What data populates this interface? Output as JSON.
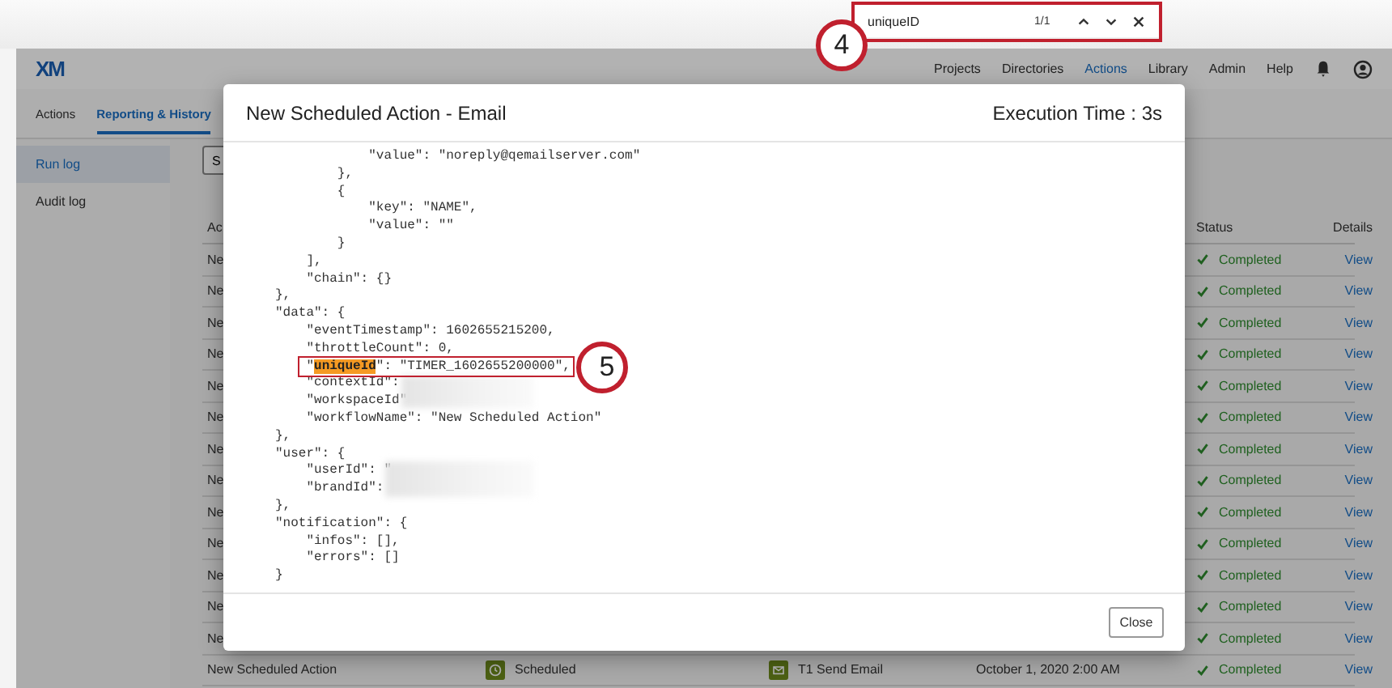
{
  "find_bar": {
    "value": "uniqueID",
    "count": "1/1"
  },
  "callouts": [
    {
      "number": "4",
      "kind": "find"
    },
    {
      "number": "5",
      "kind": "line"
    }
  ],
  "header": {
    "logo": "XM",
    "nav": [
      {
        "label": "Projects",
        "selected": false
      },
      {
        "label": "Directories",
        "selected": false
      },
      {
        "label": "Actions",
        "selected": true
      },
      {
        "label": "Library",
        "selected": false
      },
      {
        "label": "Admin",
        "selected": false
      },
      {
        "label": "Help",
        "selected": false
      }
    ]
  },
  "tabs": [
    {
      "label": "Actions",
      "selected": false
    },
    {
      "label": "Reporting & History",
      "selected": true
    }
  ],
  "sidebar": {
    "items": [
      {
        "label": "Run log",
        "selected": true
      },
      {
        "label": "Audit log",
        "selected": false
      }
    ]
  },
  "search": {
    "value": "S"
  },
  "table": {
    "columns": [
      "Ac",
      "Status",
      "Details"
    ],
    "rows": [
      {
        "action": "Ne",
        "status": {
          "text": "Completed",
          "kind": "completed"
        },
        "details": "View"
      },
      {
        "action": "Ne",
        "status": {
          "text": "Completed",
          "kind": "completed"
        },
        "details": "View"
      },
      {
        "action": "Ne",
        "status": {
          "text": "Completed",
          "kind": "completed"
        },
        "details": "View"
      },
      {
        "action": "Ne",
        "status": {
          "text": "Completed",
          "kind": "completed"
        },
        "details": "View"
      },
      {
        "action": "Ne",
        "status": {
          "text": "Completed",
          "kind": "completed"
        },
        "details": "View"
      },
      {
        "action": "Ne",
        "status": {
          "text": "Completed",
          "kind": "completed"
        },
        "details": "View"
      },
      {
        "action": "Ne",
        "status": {
          "text": "Completed",
          "kind": "completed"
        },
        "details": "View"
      },
      {
        "action": "Ne",
        "status": {
          "text": "Completed",
          "kind": "completed"
        },
        "details": "View"
      },
      {
        "action": "Ne",
        "status": {
          "text": "Completed",
          "kind": "completed"
        },
        "details": "View"
      },
      {
        "action": "Ne",
        "status": {
          "text": "Completed",
          "kind": "completed"
        },
        "details": "View"
      },
      {
        "action": "Ne",
        "status": {
          "text": "Completed",
          "kind": "completed"
        },
        "details": "View"
      },
      {
        "action": "Ne",
        "status": {
          "text": "Completed",
          "kind": "completed"
        },
        "details": "View"
      },
      {
        "action": "Ne",
        "status": {
          "text": "Completed",
          "kind": "completed"
        },
        "details": "View"
      },
      {
        "action": "New Scheduled Action",
        "trigger": "Scheduled",
        "task": "T1 Send Email",
        "date": "October 1, 2020 2:00 AM",
        "status": {
          "text": "Completed",
          "kind": "completed"
        },
        "details": "View"
      }
    ]
  },
  "modal": {
    "title": "New Scheduled Action - Email",
    "execution_time": "Execution Time : 3s",
    "close": "Close",
    "lines": [
      {
        "kind": "plain",
        "text": "            \"value\": \"noreply@qemailserver.com\""
      },
      {
        "kind": "plain",
        "text": "        },"
      },
      {
        "kind": "plain",
        "text": "        {"
      },
      {
        "kind": "plain",
        "text": "            \"key\": \"NAME\","
      },
      {
        "kind": "plain",
        "text": "            \"value\": \"\""
      },
      {
        "kind": "plain",
        "text": "        }"
      },
      {
        "kind": "plain",
        "text": "    ],"
      },
      {
        "kind": "plain",
        "text": "    \"chain\": {}"
      },
      {
        "kind": "plain",
        "text": "},"
      },
      {
        "kind": "plain",
        "text": "\"data\": {"
      },
      {
        "kind": "plain",
        "text": "    \"eventTimestamp\": 1602655215200,"
      },
      {
        "kind": "plain",
        "text": "    \"throttleCount\": 0,"
      },
      {
        "kind": "match",
        "parts": [
          "    \"",
          "uniqueId",
          "\": \"TIMER_1602655200000\","
        ]
      },
      {
        "kind": "plain",
        "text": "    \"contextId\":"
      },
      {
        "kind": "plain",
        "text": "    \"workspaceId\""
      },
      {
        "kind": "plain",
        "text": "    \"workflowName\": \"New Scheduled Action\""
      },
      {
        "kind": "plain",
        "text": "},"
      },
      {
        "kind": "plain",
        "text": "\"user\": {"
      },
      {
        "kind": "plain",
        "text": "    \"userId\": \""
      },
      {
        "kind": "plain",
        "text": "    \"brandId\":"
      },
      {
        "kind": "plain",
        "text": "},"
      },
      {
        "kind": "plain",
        "text": "\"notification\": {"
      },
      {
        "kind": "plain",
        "text": "    \"infos\": [],"
      },
      {
        "kind": "plain",
        "text": "    \"errors\": []"
      },
      {
        "kind": "plain",
        "text": "}"
      }
    ]
  }
}
